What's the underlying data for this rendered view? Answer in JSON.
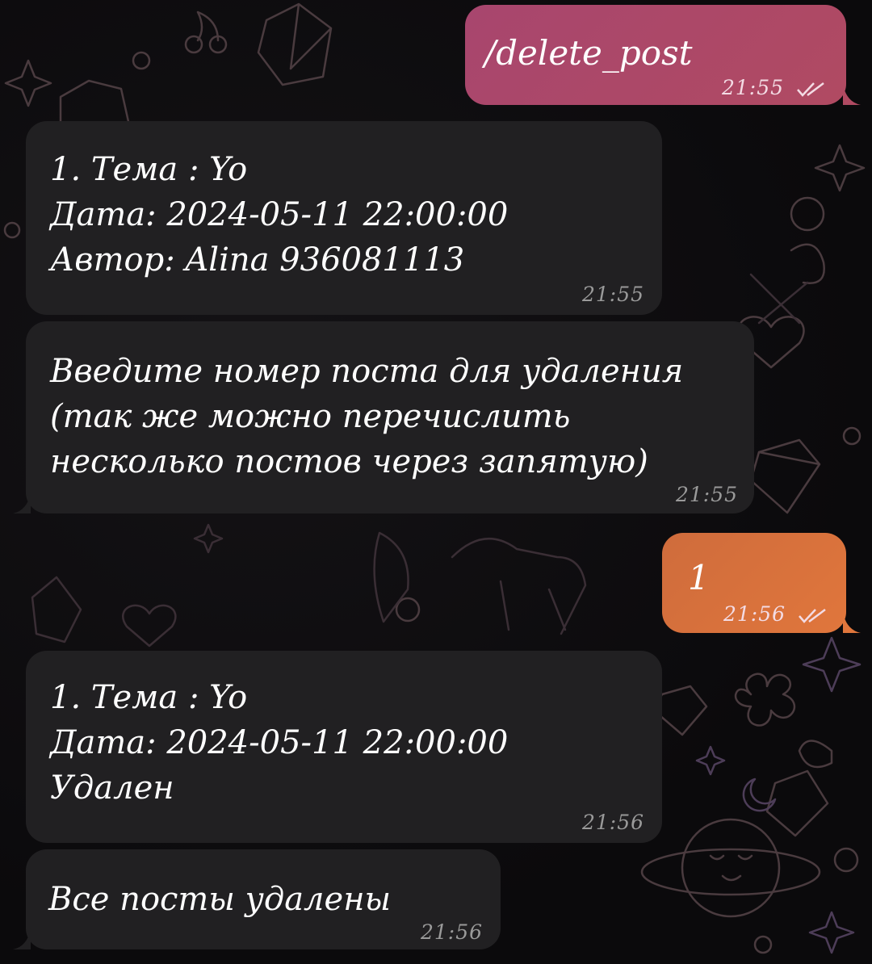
{
  "chat": {
    "messages": [
      {
        "id": "m1",
        "direction": "outgoing",
        "text": "/delete_post",
        "time": "21:55",
        "status": "read"
      },
      {
        "id": "m2",
        "direction": "incoming",
        "text": "1. Тема : Yo\nДата: 2024-05-11 22:00:00\nАвтор: Alina 936081113",
        "time": "21:55"
      },
      {
        "id": "m3",
        "direction": "incoming",
        "text": "Введите номер поста для удаления\n(так же можно перечислить\nнесколько постов через запятую)",
        "time": "21:55"
      },
      {
        "id": "m4",
        "direction": "outgoing",
        "text": "1",
        "time": "21:56",
        "status": "read"
      },
      {
        "id": "m5",
        "direction": "incoming",
        "text": "1. Тема : Yo\nДата: 2024-05-11 22:00:00\nУдален",
        "time": "21:56"
      },
      {
        "id": "m6",
        "direction": "incoming",
        "text": "Все посты удалены",
        "time": "21:56"
      }
    ],
    "icons": {
      "read_receipt": "double-check-icon",
      "wallpaper": "doodle-pattern"
    }
  },
  "colors": {
    "incoming_bubble": "#212022",
    "outgoing_gradient_top": "#a8466e",
    "outgoing_gradient_bottom": "#e0763c",
    "background": "#0b0a0c",
    "timestamp_incoming": "#9a9a9a"
  }
}
